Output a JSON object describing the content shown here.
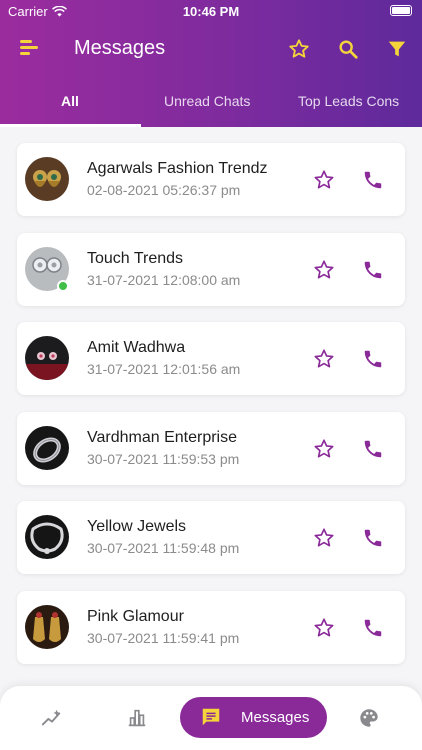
{
  "status_bar": {
    "carrier": "Carrier",
    "time": "10:46 PM"
  },
  "header": {
    "title": "Messages",
    "icons": [
      "menu-icon",
      "star-icon",
      "search-icon",
      "filter-icon"
    ],
    "accent_color": "#f4d43a"
  },
  "tabs": [
    {
      "label": "All",
      "active": true
    },
    {
      "label": "Unread Chats",
      "active": false
    },
    {
      "label": "Top Leads Cons",
      "active": false
    }
  ],
  "chats": [
    {
      "name": "Agarwals Fashion Trendz",
      "timestamp": "02-08-2021 05:26:37 pm",
      "online": false
    },
    {
      "name": "Touch Trends",
      "timestamp": "31-07-2021 12:08:00 am",
      "online": true
    },
    {
      "name": "Amit Wadhwa",
      "timestamp": "31-07-2021 12:01:56 am",
      "online": false
    },
    {
      "name": "Vardhman Enterprise",
      "timestamp": "30-07-2021 11:59:53 pm",
      "online": false
    },
    {
      "name": "Yellow Jewels",
      "timestamp": "30-07-2021 11:59:48 pm",
      "online": false
    },
    {
      "name": "Pink Glamour",
      "timestamp": "30-07-2021 11:59:41 pm",
      "online": false
    }
  ],
  "bottom_nav": {
    "items": [
      {
        "icon": "trending-icon"
      },
      {
        "icon": "bar-chart-icon"
      },
      {
        "icon": "message-icon",
        "label": "Messages",
        "active": true
      },
      {
        "icon": "palette-icon"
      }
    ]
  },
  "colors": {
    "primary": "#8a2a99",
    "header_start": "#9b2c9e",
    "header_end": "#5e2a9c",
    "online": "#3fbf47"
  }
}
